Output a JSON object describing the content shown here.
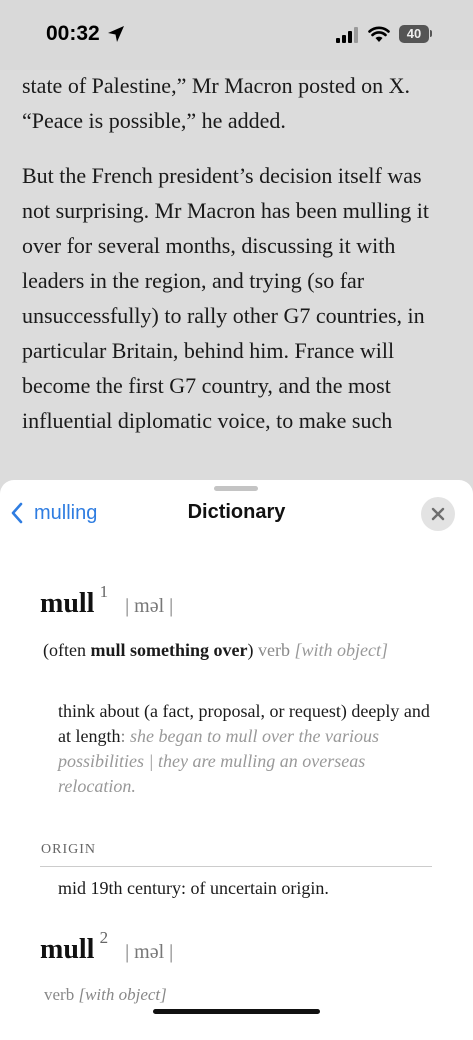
{
  "status": {
    "time": "00:32",
    "battery": "40"
  },
  "article": {
    "para1": "state of Palestine,” Mr Macron posted on X. “Peace is possible,” he added.",
    "para2_a": "But the French president’s decision itself was not surprising. Mr Macron has been mulling it over for several months, discussing it with leaders in the region, and trying (so far unsuccessfully) to rally other ",
    "g7_1": "G7",
    "para2_b": " countries, in particular Britain, behind him. France will become the first ",
    "g7_2": "G7",
    "para2_c": " country, and the most influential diplomatic voice, to make such"
  },
  "dictionary": {
    "back_label": "mulling",
    "title": "Dictionary",
    "entry1": {
      "headword": "mull",
      "homograph": "1",
      "pronunciation": "| məl |",
      "usage_open": "(often ",
      "usage_bold": "mull something over",
      "usage_close": ")",
      "pos": "verb",
      "grammar": "[with object]",
      "definition": "think about (a fact, proposal, or request) deeply and at length",
      "example_sep": ": ",
      "example": "she began to mull over the various possibilities | they are mulling an overseas relocation."
    },
    "origin": {
      "label": "ORIGIN",
      "text": "mid 19th century: of uncertain origin."
    },
    "entry2": {
      "headword": "mull",
      "homograph": "2",
      "pronunciation": "| məl |",
      "pos": "verb",
      "grammar": "[with object]"
    }
  }
}
